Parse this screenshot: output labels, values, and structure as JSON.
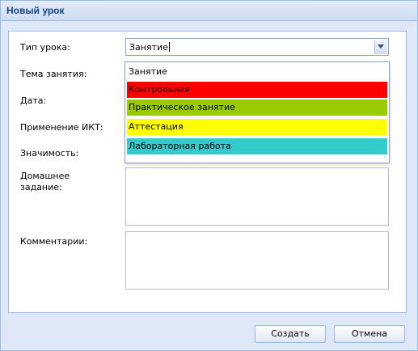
{
  "window": {
    "title": "Новый урок"
  },
  "form": {
    "type_label": "Тип урока:",
    "type_value": "Занятие",
    "topic_label": "Тема занятия:",
    "date_label": "Дата:",
    "ict_label": "Применение ИКТ:",
    "significance_label": "Значимость:",
    "homework_label_line1": "Домашнее",
    "homework_label_line2": "задание:",
    "comments_label": "Комментарии:"
  },
  "dropdown": {
    "options": [
      {
        "label": "Занятие",
        "color": "#ffffff"
      },
      {
        "label": "Контрольная",
        "color": "#ff0000"
      },
      {
        "label": "Практическое занятие",
        "color": "#99cc00"
      },
      {
        "label": "Аттестация",
        "color": "#ffff00"
      },
      {
        "label": "Лабораторная работа",
        "color": "#33cccc"
      }
    ]
  },
  "buttons": {
    "create": "Создать",
    "cancel": "Отмена"
  }
}
